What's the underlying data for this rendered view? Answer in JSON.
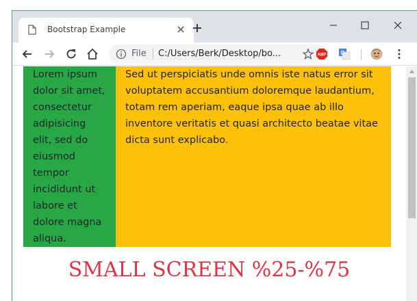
{
  "tab": {
    "title": "Bootstrap Example",
    "favicon": "document-icon"
  },
  "address_bar": {
    "scheme_label": "File",
    "url": "C:/Users/Berk/Desktop/bo..."
  },
  "extensions": [
    "adblock-plus-icon",
    "google-translate-icon",
    "profile-avatar"
  ],
  "extension_labels": {
    "abp": "ABP"
  },
  "page": {
    "green_column_text": "Lorem ipsum dolor sit amet, consectetur adipisicing elit, sed do eiusmod tempor incididunt ut labore et dolore magna aliqua.",
    "yellow_column_text": "Sed ut perspiciatis unde omnis iste natus error sit voluptatem accusantium doloremque laudantium, totam rem aperiam, eaque ipsa quae ab illo inventore veritatis et quasi architecto beatae vitae dicta sunt explicabo.",
    "heading": "SMALL SCREEN %25-%75"
  },
  "colors": {
    "green": "#28a745",
    "yellow": "#ffc107",
    "heading_red": "#dc3545"
  }
}
